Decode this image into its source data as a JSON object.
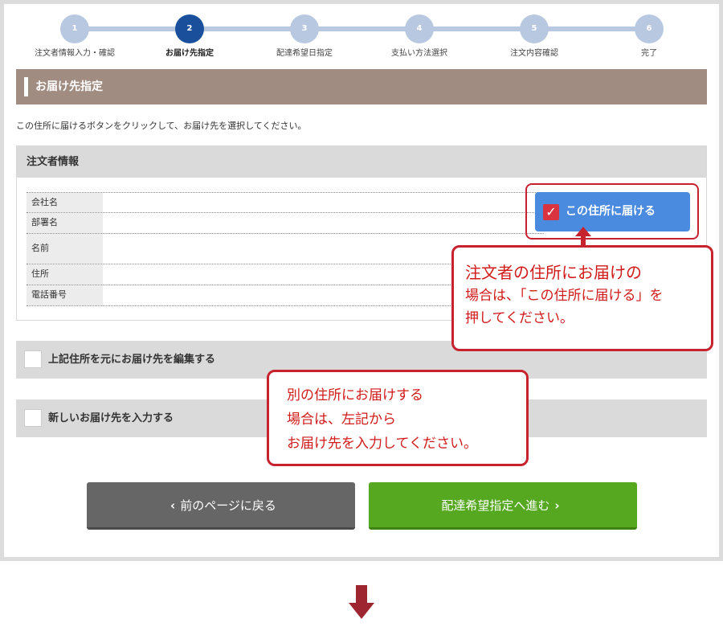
{
  "stepper": {
    "steps": [
      {
        "num": "1",
        "label": "注文者情報入力・確認"
      },
      {
        "num": "2",
        "label": "お届け先指定"
      },
      {
        "num": "3",
        "label": "配達希望日指定"
      },
      {
        "num": "4",
        "label": "支払い方法選択"
      },
      {
        "num": "5",
        "label": "注文内容確認"
      },
      {
        "num": "6",
        "label": "完了"
      }
    ],
    "active_step": "2"
  },
  "section": {
    "title": "お届け先指定"
  },
  "instruction": "この住所に届けるボタンをクリックして、お届け先を選択してください。",
  "orderer": {
    "title": "注文者情報",
    "rows": [
      {
        "label": "会社名",
        "value": ""
      },
      {
        "label": "部署名",
        "value": ""
      },
      {
        "label": "名前",
        "value": ""
      },
      {
        "label": "住所",
        "value": ""
      },
      {
        "label": "電話番号",
        "value": ""
      }
    ],
    "deliver_button": "この住所に届ける"
  },
  "options": {
    "edit_label": "上記住所を元にお届け先を編集する",
    "new_label": "新しいお届け先を入力する"
  },
  "callouts": {
    "first": {
      "line1": "注文者の住所にお届けの",
      "line2": "場合は、「この住所に届ける」を",
      "line3": "押してください。"
    },
    "second": {
      "line1": "別の住所にお届けする",
      "line2": "場合は、左記から",
      "line3": "お届け先を入力してください。"
    }
  },
  "buttons": {
    "back": "前のページに戻る",
    "next": "配達希望指定へ進む"
  },
  "colors": {
    "section_header": "#a08c80",
    "active_step": "#1a4f9c",
    "deliver_button": "#4a8be0",
    "callout_border": "#c7232f",
    "back_button": "#666666",
    "next_button": "#55a820"
  }
}
